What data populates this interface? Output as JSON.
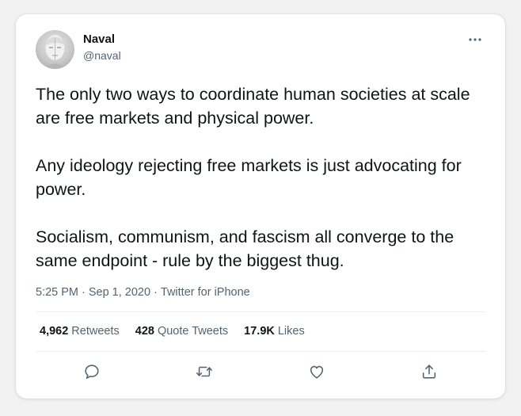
{
  "user": {
    "name": "Naval",
    "handle": "@naval",
    "avatar_icon": "statue-head-avatar"
  },
  "tweet": {
    "paragraphs": [
      "The only two ways to coordinate human societies at scale are free markets and physical power.",
      "Any ideology rejecting free markets is just advocating for power.",
      "Socialism, communism, and fascism all converge to the same endpoint - rule by the biggest thug."
    ]
  },
  "meta": {
    "time": "5:25 PM",
    "date": "Sep 1, 2020",
    "separator": "·",
    "source": "Twitter for iPhone"
  },
  "stats": {
    "retweets_count": "4,962",
    "retweets_label": "Retweets",
    "quotes_count": "428",
    "quotes_label": "Quote Tweets",
    "likes_count": "17.9K",
    "likes_label": "Likes"
  },
  "actions": {
    "reply_icon": "reply-icon",
    "retweet_icon": "retweet-icon",
    "like_icon": "heart-icon",
    "share_icon": "share-icon",
    "more_icon": "more-icon"
  },
  "colors": {
    "text_primary": "#0f1419",
    "text_secondary": "#536471",
    "icon": "#536471",
    "divider": "#eceff1",
    "card_bg": "#ffffff",
    "page_bg": "#f2f2f2"
  }
}
